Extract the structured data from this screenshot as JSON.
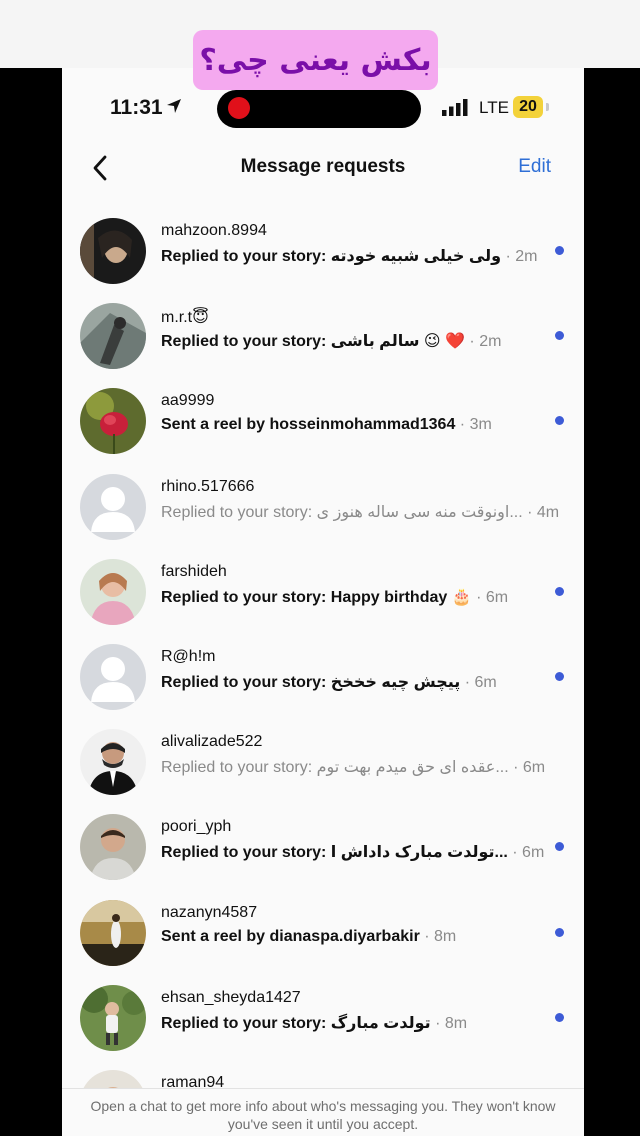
{
  "overlay": {
    "caption": "بکش یعنی چی؟"
  },
  "status_bar": {
    "time": "11:31",
    "network": "LTE",
    "battery": "20",
    "recording": true
  },
  "nav": {
    "title": "Message requests",
    "edit_label": "Edit",
    "back_icon": "chevron-left-icon"
  },
  "requests": [
    {
      "username": "mahzoon.8994",
      "prefix": "Replied to your story: ",
      "message": "ولی خیلی شبیه خودته",
      "time": " · 2m",
      "unread": true
    },
    {
      "username": "m.r.t😇",
      "prefix": "Replied to your story: ",
      "message": "❤️ 😉 سالم باشی",
      "time": " · 2m",
      "unread": true
    },
    {
      "username": "aa9999",
      "prefix": "Sent a reel by ",
      "message": "hosseinmohammad1364",
      "time": " · 3m",
      "unread": true
    },
    {
      "username": "rhino.517666",
      "prefix": "Replied to your story: ",
      "message": "...اونوقت منه سی ساله هنوز ی",
      "time": " · 4m",
      "unread": false
    },
    {
      "username": "farshideh",
      "prefix": "Replied to your story: ",
      "message": "Happy birthday 🎂",
      "time": " · 6m",
      "unread": true
    },
    {
      "username": "R@h!m",
      "prefix": "Replied to your story: ",
      "message": "پیچش چیه خخخخ",
      "time": " · 6m",
      "unread": true
    },
    {
      "username": "alivalizade522",
      "prefix": "Replied to your story: ",
      "message": "...عقده ای حق میدم بهت توم",
      "time": " · 6m",
      "unread": false
    },
    {
      "username": "poori_yph",
      "prefix": "Replied to your story: ",
      "message": "...تولدت مبارک داداش ا",
      "time": " · 6m",
      "unread": true
    },
    {
      "username": "nazanyn4587",
      "prefix": "Sent a reel by ",
      "message": "dianaspa.diyarbakir",
      "time": " · 8m",
      "unread": true
    },
    {
      "username": "ehsan_sheyda1427",
      "prefix": "Replied to your story: ",
      "message": "تولدت مبارگ",
      "time": " · 8m",
      "unread": true
    },
    {
      "username": "raman94",
      "prefix": "",
      "message": "",
      "time": "",
      "unread": false
    }
  ],
  "footer": {
    "notice": "Open a chat to get more info about who's messaging you. They won't know you've seen it until you accept."
  },
  "colors": {
    "accent": "#2f6fd6",
    "unread_dot": "#3d5bd6",
    "caption_bg": "#f4a9ef",
    "caption_text": "#7a0fa8"
  }
}
